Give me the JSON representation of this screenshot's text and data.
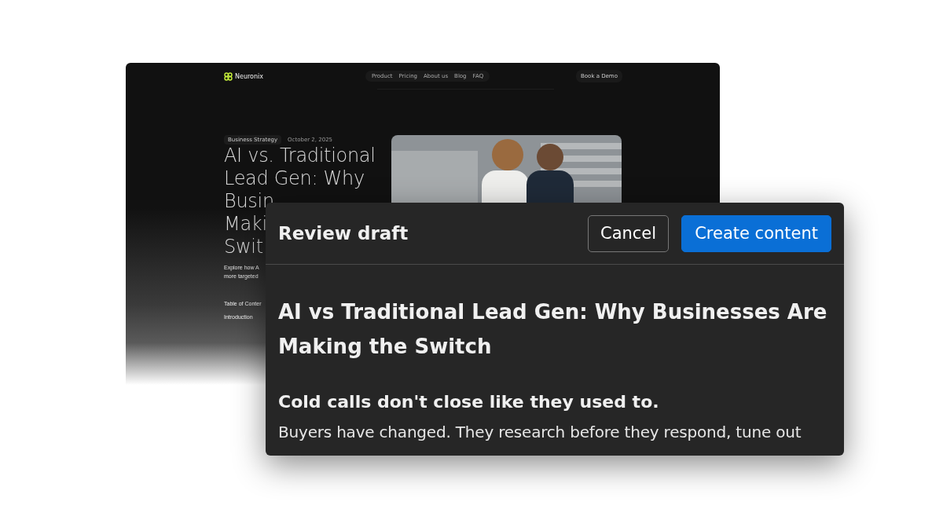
{
  "site": {
    "logo": "Neuronix",
    "nav": [
      {
        "label": "Product"
      },
      {
        "label": "Pricing"
      },
      {
        "label": "About us"
      },
      {
        "label": "Blog"
      },
      {
        "label": "FAQ"
      }
    ],
    "cta": "Book a Demo",
    "tag": "Business Strategy",
    "date": "October 2, 2025",
    "title_lines": [
      "AI vs. Traditional",
      "Lead Gen: Why",
      "Busin",
      "Maki",
      "Swit"
    ],
    "excerpt_lines": [
      "Explore how A",
      "more targeted"
    ],
    "toc_title": "Table of Conter",
    "toc": [
      "Introduction"
    ],
    "image": {
      "kind": "picture"
    }
  },
  "dialog": {
    "title": "Review draft",
    "buttons": [
      {
        "label": "Cancel",
        "kind": "secondary"
      },
      {
        "label": "Create content",
        "kind": "primary"
      }
    ],
    "heading": "AI vs Traditional Lead Gen: Why Businesses Are Making the Switch",
    "subheading": "Cold calls don't close like they used to.",
    "body": "Buyers have changed. They research before they respond, tune out"
  }
}
